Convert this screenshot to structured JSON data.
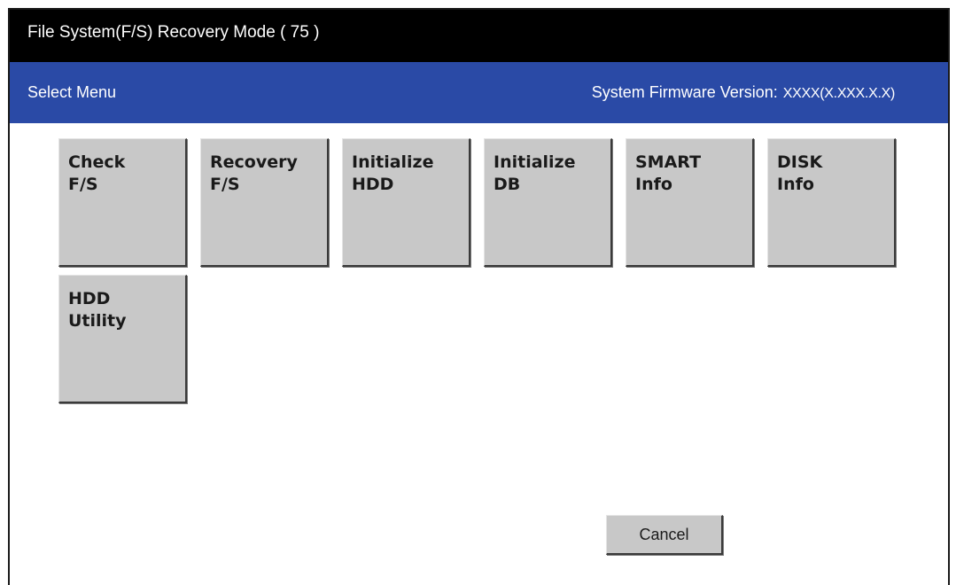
{
  "window": {
    "title": "File System(F/S) Recovery Mode ( 75 )"
  },
  "header": {
    "menu_label": "Select Menu",
    "firmware_label": "System Firmware Version:",
    "firmware_value": "XXXX(X.XXX.X.X)"
  },
  "menu": {
    "items": [
      {
        "line1": "Check",
        "line2": "F/S"
      },
      {
        "line1": "Recovery",
        "line2": "F/S"
      },
      {
        "line1": "Initialize",
        "line2": "HDD"
      },
      {
        "line1": "Initialize",
        "line2": "DB"
      },
      {
        "line1": "SMART",
        "line2": "Info"
      },
      {
        "line1": "DISK",
        "line2": "Info"
      },
      {
        "line1": "HDD",
        "line2": "Utility"
      }
    ]
  },
  "footer": {
    "cancel_label": "Cancel"
  },
  "colors": {
    "title_bar": "#000000",
    "header_bar": "#2a4aa6",
    "button_face": "#c8c8c8"
  }
}
